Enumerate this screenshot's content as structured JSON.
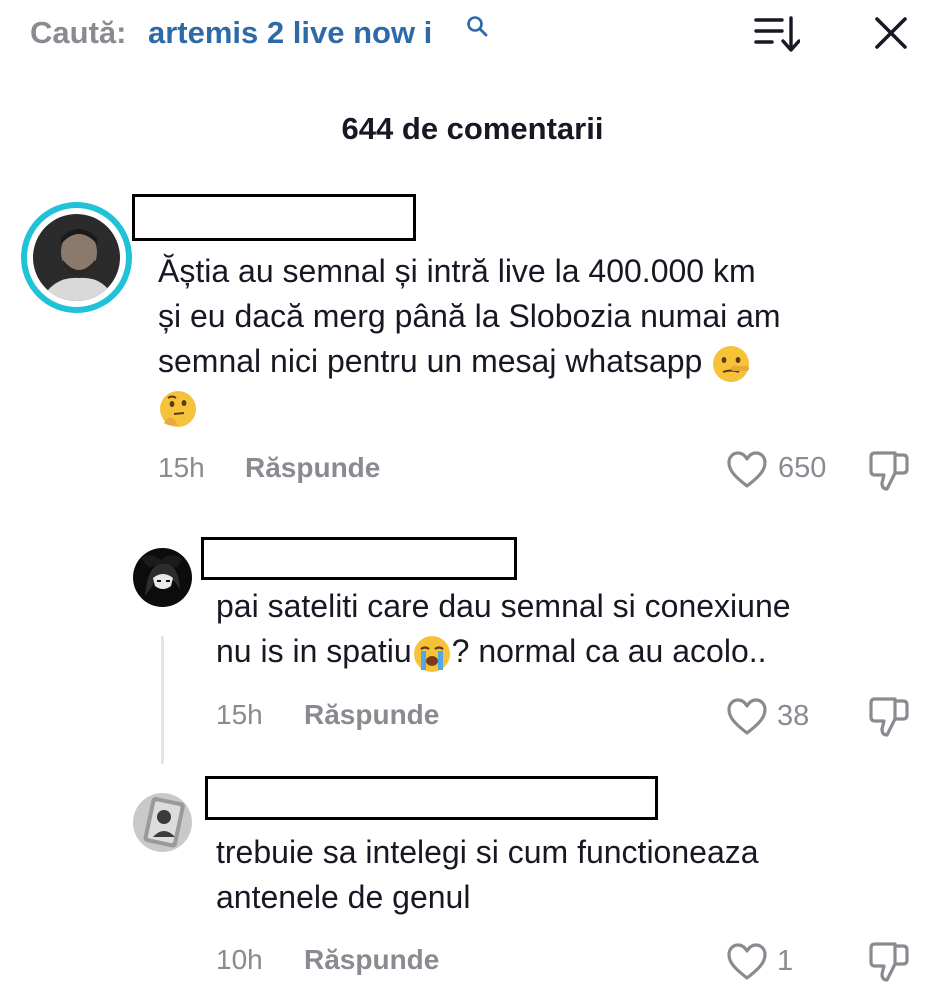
{
  "search": {
    "prefix": "Caută:",
    "query": "artemis 2 live now i"
  },
  "icons": {
    "search": "search-icon",
    "sort": "sort-icon",
    "close": "close-icon",
    "like": "heart-icon",
    "dislike": "thumbs-down-icon"
  },
  "header": {
    "title": "644 de comentarii"
  },
  "comments": [
    {
      "text_line1": "Ăștia au semnal și intră live la 400.000 km",
      "text_line2": "și eu dacă merg până la Slobozia numai am",
      "text_line3": "semnal nici pentru un mesaj whatsapp",
      "emoji1": "🤥",
      "emoji2": "🤔",
      "time": "15h",
      "reply_label": "Răspunde",
      "likes": "650"
    },
    {
      "text_line1": "pai sateliti care dau semnal si conexiune",
      "text_line2_a": "nu is in spatiu",
      "emoji": "😭",
      "text_line2_b": "? normal ca au acolo..",
      "time": "15h",
      "reply_label": "Răspunde",
      "likes": "38"
    },
    {
      "text_line1": "trebuie sa intelegi si cum functioneaza",
      "text_line2": "antenele de genul",
      "time": "10h",
      "reply_label": "Răspunde",
      "likes": "1"
    }
  ],
  "colors": {
    "accent_ring": "#20c2d8",
    "query_blue": "#2f6aa8",
    "muted": "#8a8b91"
  }
}
